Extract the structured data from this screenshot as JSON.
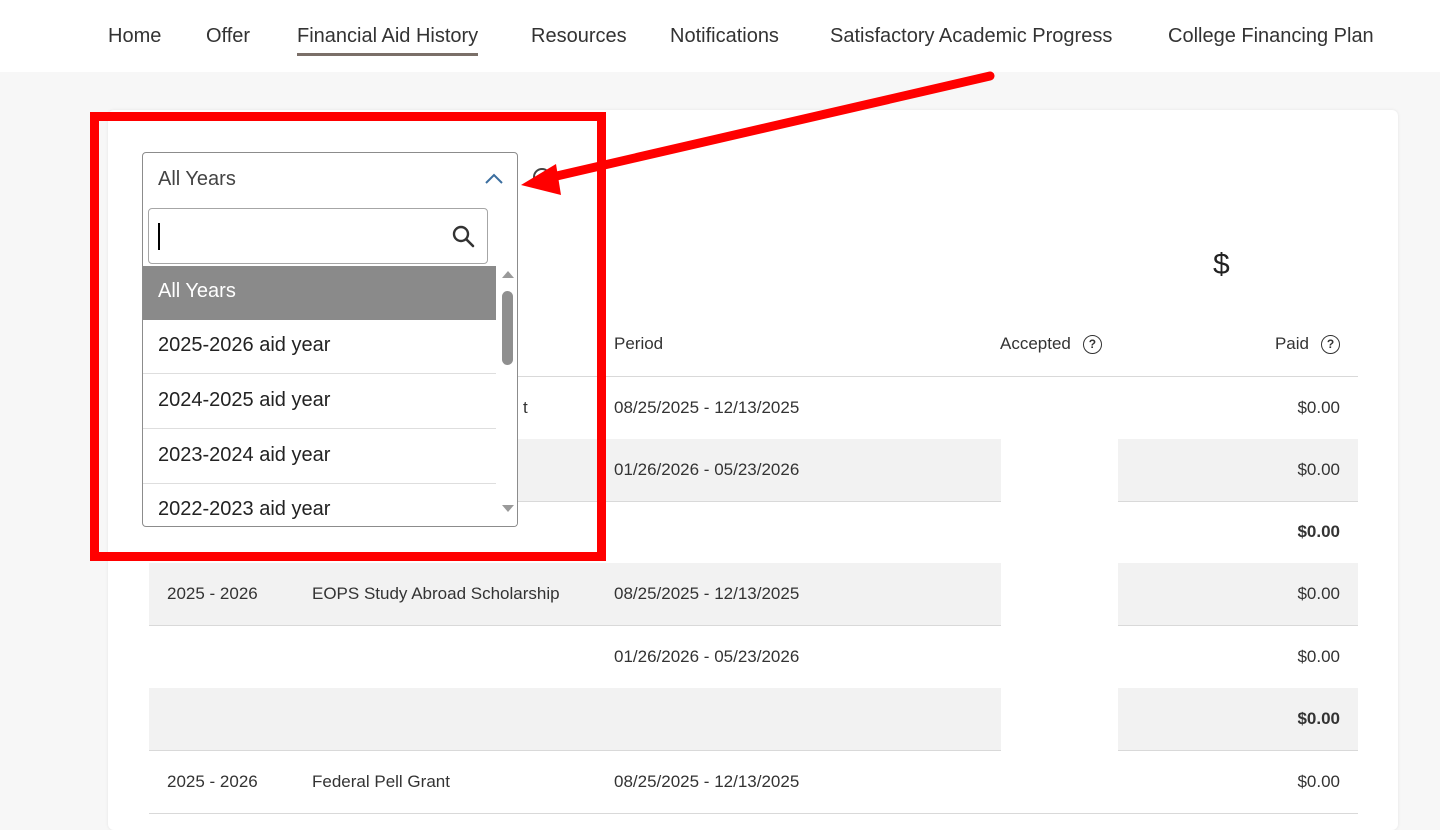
{
  "nav": {
    "items": [
      {
        "label": "Home"
      },
      {
        "label": "Offer"
      },
      {
        "label": "Financial Aid History",
        "active": true
      },
      {
        "label": "Resources"
      },
      {
        "label": "Notifications"
      },
      {
        "label": "Satisfactory Academic Progress"
      },
      {
        "label": "College Financing Plan"
      }
    ]
  },
  "summary": {
    "currency_symbol": "$"
  },
  "year_select": {
    "value": "All Years",
    "search_value": "",
    "options": [
      {
        "label": "All Years",
        "selected": true
      },
      {
        "label": "2025-2026 aid year"
      },
      {
        "label": "2024-2025 aid year"
      },
      {
        "label": "2023-2024 aid year"
      },
      {
        "label": "2022-2023 aid year"
      }
    ]
  },
  "table": {
    "headers": {
      "period": "Period",
      "accepted": "Accepted",
      "paid": "Paid"
    },
    "help_glyph": "?",
    "rows": [
      {
        "year": "",
        "name": "t",
        "period": "08/25/2025 - 12/13/2025",
        "paid": "$0.00"
      },
      {
        "year": "",
        "name": "",
        "period": "01/26/2026 - 05/23/2026",
        "paid": "$0.00"
      },
      {
        "year": "",
        "name": "",
        "period": "",
        "paid": "$0.00",
        "total": true
      },
      {
        "year": "2025 - 2026",
        "name": "EOPS Study Abroad Scholarship",
        "period": "08/25/2025 - 12/13/2025",
        "paid": "$0.00"
      },
      {
        "year": "",
        "name": "",
        "period": "01/26/2026 - 05/23/2026",
        "paid": "$0.00"
      },
      {
        "year": "",
        "name": "",
        "period": "",
        "paid": "$0.00",
        "total": true
      },
      {
        "year": "2025 - 2026",
        "name": "Federal Pell Grant",
        "period": "08/25/2025 - 12/13/2025",
        "paid": "$0.00"
      }
    ]
  },
  "icons": {
    "search": "search-icon",
    "chevron": "chevron-up-icon",
    "help": "help-circle-icon"
  },
  "colors": {
    "annotation": "#ff0000",
    "selected_option": "#8a8a8a",
    "row_shade": "#f2f2f2"
  }
}
